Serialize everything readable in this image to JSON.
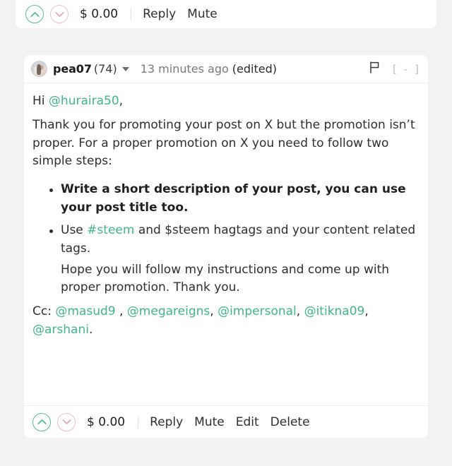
{
  "theme": {
    "page_background": "#f2f2f2",
    "card_background": "#ffffff",
    "accent_link": "#3fb68b",
    "upvote_color": "#53b99a",
    "downvote_color": "#e0a9ad",
    "text_color": "#2e2e2e",
    "muted_text": "#7a7a7a"
  },
  "parent_comment_actions": {
    "upvote_icon": "chevron-up-icon",
    "downvote_icon": "chevron-down-icon",
    "payout": "$ 0.00",
    "reply_label": "Reply",
    "mute_label": "Mute"
  },
  "comment": {
    "header": {
      "avatar_icon": "user-avatar",
      "author": "pea07",
      "reputation": "(74)",
      "dropdown_icon": "caret-down-icon",
      "timestamp": "13 minutes ago",
      "edited_label": "(edited)",
      "flag_icon": "flag-icon",
      "collapse_label": "[ - ]"
    },
    "body": {
      "greeting_prefix": "Hi ",
      "greeting_mention": "@huraira50",
      "greeting_suffix": ",",
      "paragraph_1": "Thank you for promoting your post on X but the promotion isn’t proper. For a proper promotion on X you need to follow two simple steps:",
      "steps": [
        {
          "bold": true,
          "text": "Write a short description of your post, you can use your post title too."
        },
        {
          "bold": false,
          "prefix": "Use ",
          "tag": "#steem",
          "suffix": " and $steem hagtags and your content related tags.",
          "followup": "Hope you will follow my instructions and come up with proper promotion. Thank you."
        }
      ],
      "cc_label": "Cc: ",
      "cc_mentions": [
        {
          "name": "@masud9",
          "separator": " , "
        },
        {
          "name": "@megareigns",
          "separator": ", "
        },
        {
          "name": "@impersonal",
          "separator": ", "
        },
        {
          "name": "@itikna09",
          "separator": ", "
        },
        {
          "name": "@arshani",
          "separator": "."
        }
      ]
    },
    "footer": {
      "upvote_icon": "chevron-up-icon",
      "downvote_icon": "chevron-down-icon",
      "payout": "$ 0.00",
      "reply_label": "Reply",
      "mute_label": "Mute",
      "edit_label": "Edit",
      "delete_label": "Delete"
    }
  }
}
